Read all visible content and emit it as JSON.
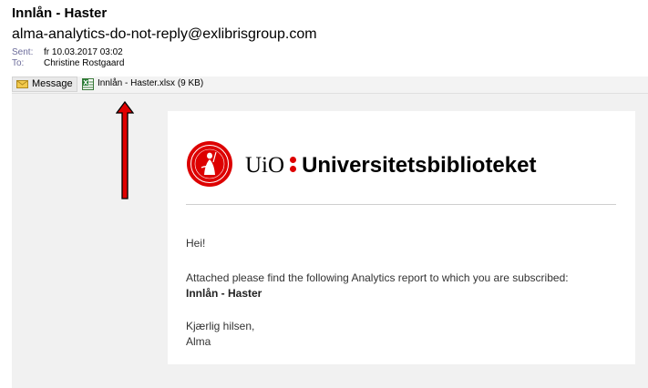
{
  "email": {
    "subject": "Innlån - Haster",
    "from": "alma-analytics-do-not-reply@exlibrisgroup.com",
    "sent_label": "Sent:",
    "sent_value": "fr 10.03.2017 03:02",
    "to_label": "To:",
    "to_value": "Christine Rostgaard"
  },
  "tabs": {
    "message_label": "Message",
    "attachment_label": "Innlån - Haster.xlsx (9 KB)"
  },
  "icons": {
    "message": "envelope-icon",
    "attachment": "excel-file-icon",
    "annotation": "red-up-arrow"
  },
  "brand": {
    "short": "UiO",
    "name": "Universitetsbiblioteket",
    "accent_color": "#dd0000"
  },
  "body": {
    "greeting": "Hei!",
    "intro": "Attached please find the following Analytics report to which you are subscribed:",
    "report_name": "Innlån - Haster",
    "closing": "Kjærlig hilsen,",
    "signature": "Alma"
  }
}
